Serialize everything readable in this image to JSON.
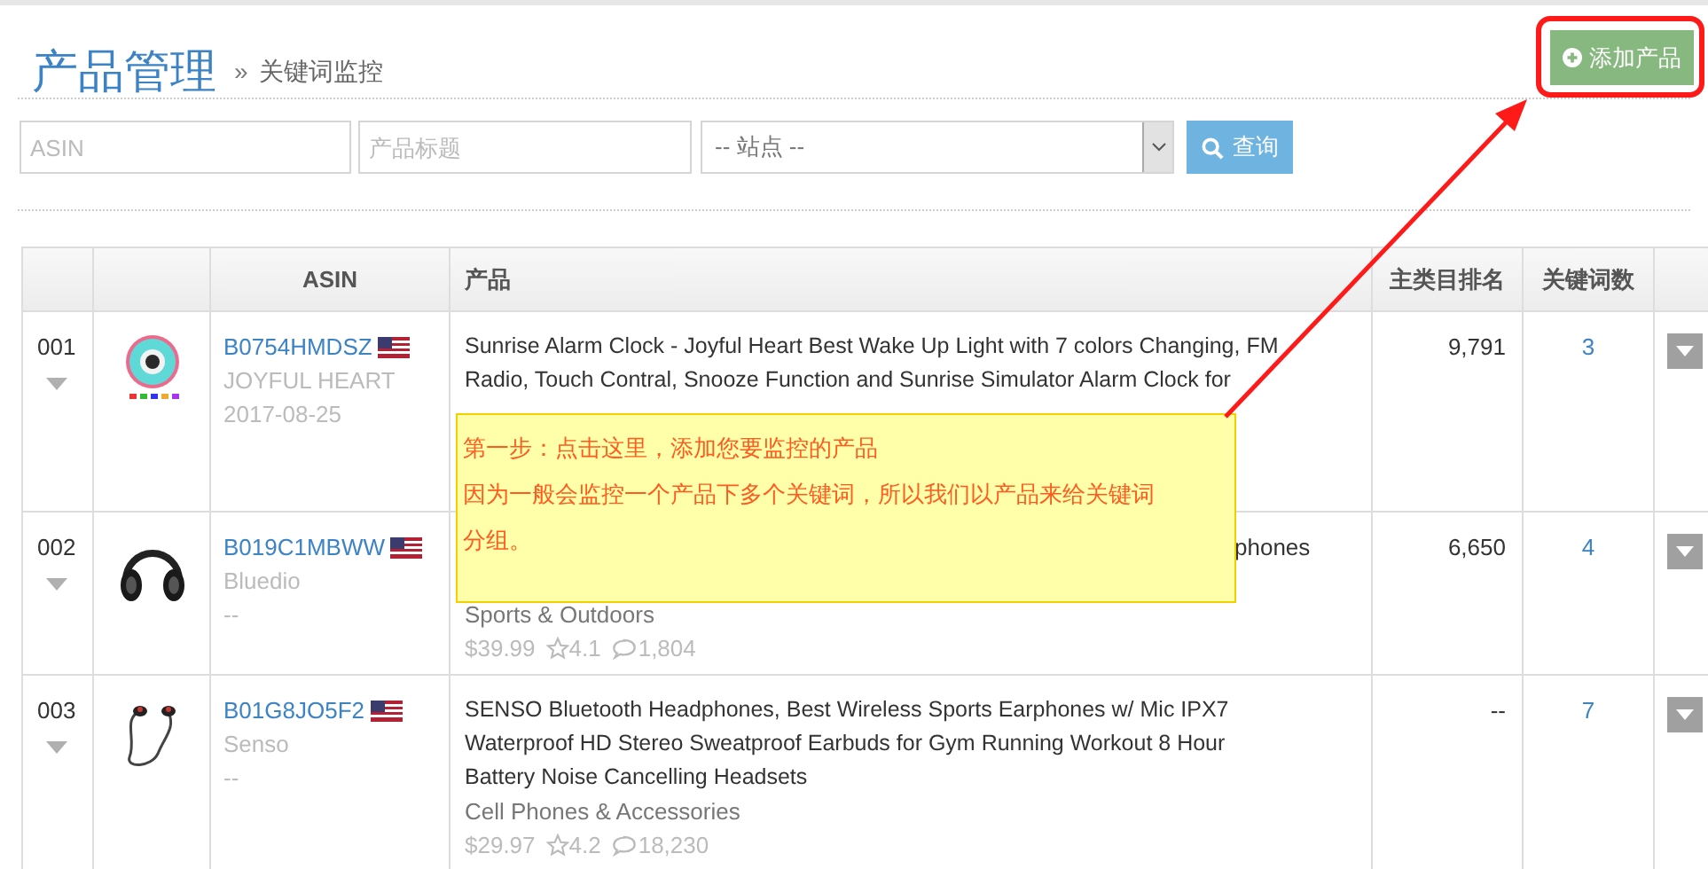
{
  "header": {
    "title": "产品管理",
    "separator": "»",
    "subtitle": "关键词监控",
    "add_button": "添加产品"
  },
  "filters": {
    "asin_placeholder": "ASIN",
    "title_placeholder": "产品标题",
    "site_value": "-- 站点 --",
    "search_button": "查询"
  },
  "table": {
    "columns": [
      "ASIN",
      "产品",
      "主类目排名",
      "关键词数"
    ],
    "rows": [
      {
        "index": "001",
        "asin": "B0754HMDSZ",
        "brand": "JOYFUL HEART",
        "date": "2017-08-25",
        "title": "Sunrise Alarm Clock - Joyful Heart Best Wake Up Light with 7 colors Changing, FM Radio, Touch Contral, Snooze Function and Sunrise Simulator Alarm Clock for",
        "covered": false,
        "rank": "9,791",
        "keywords": "3"
      },
      {
        "index": "002",
        "asin": "B019C1MBWW",
        "brand": "Bluedio",
        "date": "--",
        "title": "phones",
        "covered": true,
        "category": "Sports & Outdoors",
        "price": "$39.99",
        "rating": "4.1",
        "reviews": "1,804",
        "rank": "6,650",
        "keywords": "4"
      },
      {
        "index": "003",
        "asin": "B01G8JO5F2",
        "brand": "Senso",
        "date": "--",
        "title": "SENSO Bluetooth Headphones, Best Wireless Sports Earphones w/ Mic IPX7 Waterproof HD Stereo Sweatproof Earbuds for Gym Running Workout 8 Hour Battery Noise Cancelling Headsets",
        "covered": false,
        "category": "Cell Phones & Accessories",
        "price": "$29.97",
        "rating": "4.2",
        "reviews": "18,230",
        "rank": "--",
        "keywords": "7"
      }
    ]
  },
  "callout": {
    "lines": [
      "第一步：点击这里，添加您要监控的产品",
      "因为一般会监控一个产品下多个关键词，所以我们以产品来给关键词分组。"
    ]
  }
}
